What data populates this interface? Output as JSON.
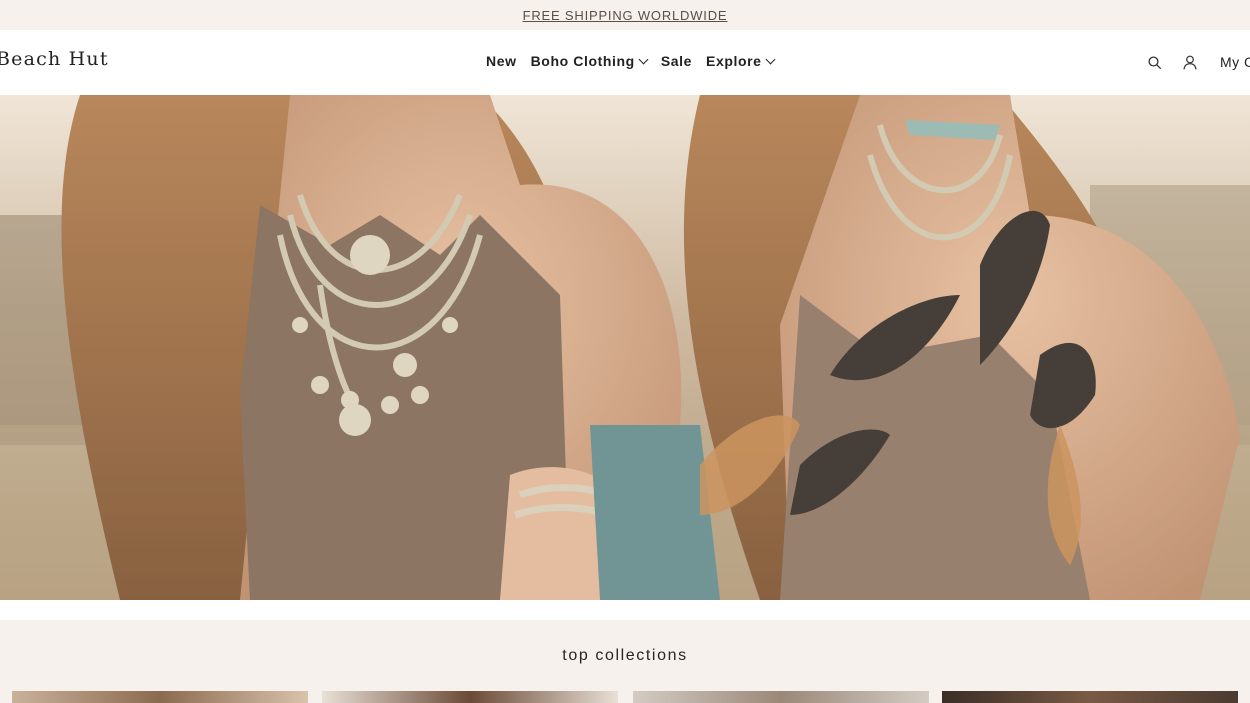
{
  "announcement": {
    "text": "FREE SHIPPING WORLDWIDE"
  },
  "header": {
    "logo": "Beach Hut",
    "nav": [
      {
        "label": "New",
        "has_dropdown": false
      },
      {
        "label": "Boho Clothing",
        "has_dropdown": true
      },
      {
        "label": "Sale",
        "has_dropdown": false
      },
      {
        "label": "Explore",
        "has_dropdown": true
      }
    ],
    "icons": [
      "search-icon",
      "account-icon"
    ],
    "cart_label": "My C"
  },
  "hero": {
    "image": "two models wearing boho knit tops, coin necklaces and feathers"
  },
  "collections": {
    "title": "top collections",
    "tiles": 4
  },
  "colors": {
    "background": "#f6f1ed",
    "header": "#ffffff",
    "text": "#222222",
    "link": "#5a4e45"
  }
}
